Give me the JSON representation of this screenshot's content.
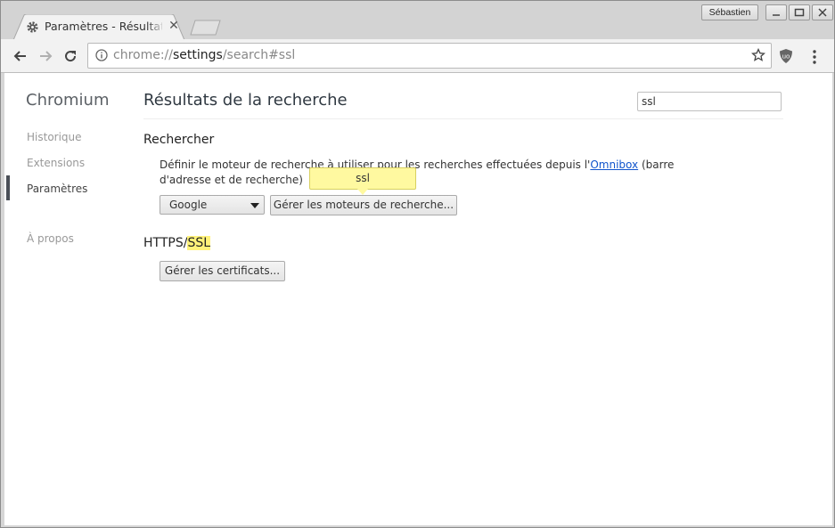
{
  "colors": {
    "highlight": "#fff27a",
    "bubble": "#fff9a0",
    "link": "#1155cc"
  },
  "tab": {
    "title": "Paramètres - Résultats",
    "close": "✕"
  },
  "profile": {
    "name": "Sébastien"
  },
  "omnibox": {
    "scheme": "chrome://",
    "host": "settings",
    "path": "/search#ssl"
  },
  "sidebar": {
    "brand": "Chromium",
    "items": [
      {
        "label": "Historique"
      },
      {
        "label": "Extensions"
      },
      {
        "label": "Paramètres"
      },
      {
        "label": "À propos"
      }
    ]
  },
  "main": {
    "heading": "Résultats de la recherche",
    "search_value": "ssl",
    "search_engine": {
      "title": "Rechercher",
      "desc_before": "Définir le moteur de recherche à utiliser pour les recherches effectuées depuis l'",
      "desc_link": "Omnibox",
      "desc_after": " (barre d'adresse et de recherche)",
      "selected": "Google",
      "manage_button": "Gérer les moteurs de recherche...",
      "bubble": "ssl"
    },
    "https": {
      "title_prefix": "HTTPS/",
      "title_match": "SSL",
      "button": "Gérer les certificats..."
    }
  }
}
